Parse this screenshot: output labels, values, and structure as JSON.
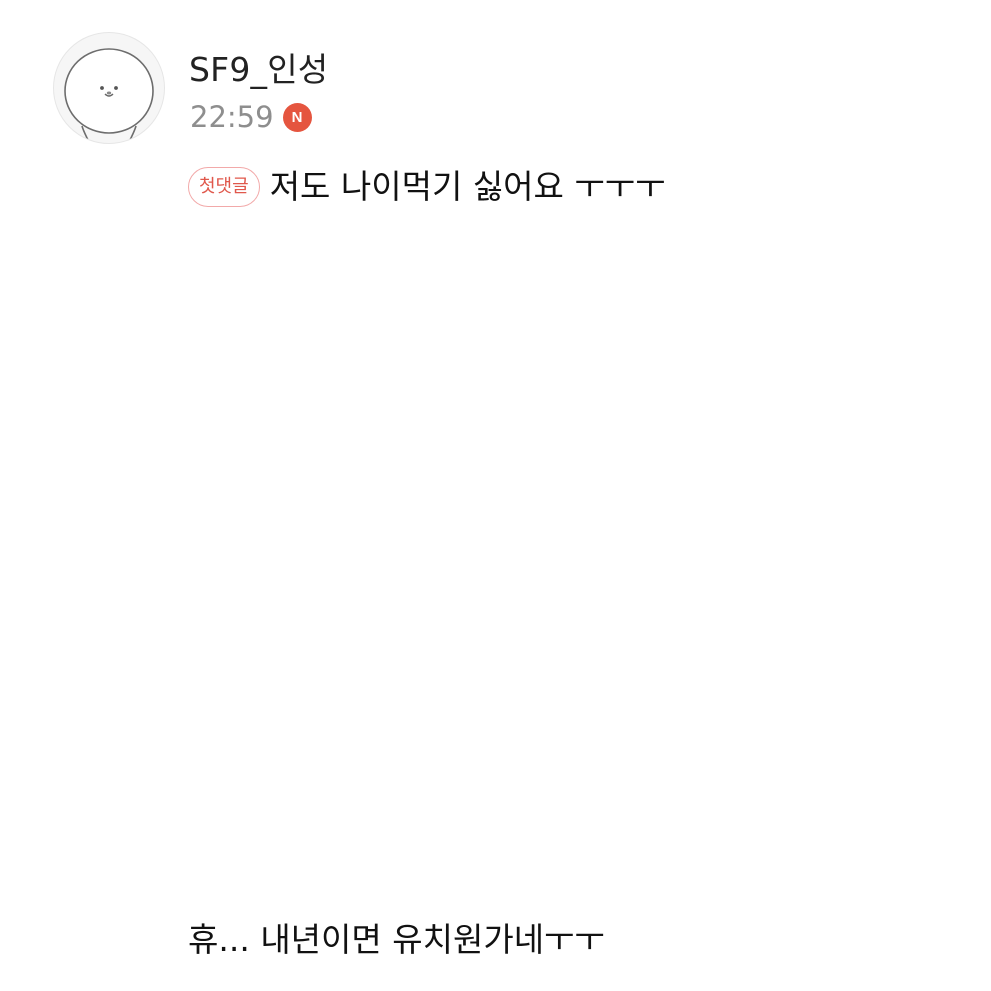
{
  "comment": {
    "author": "SF9_인성",
    "time": "22:59",
    "new_badge": "N",
    "first_comment_badge": "첫댓글",
    "text": "저도 나이먹기 싫어요 ㅜㅜㅜ",
    "avatar_icon": "cartoon-face-avatar-icon"
  },
  "bottom": {
    "text": "휴... 내년이면 유치원가네ㅜㅜ"
  },
  "colors": {
    "new_badge_bg": "#e5553f",
    "first_badge_text": "#e0584c",
    "first_badge_border": "#f2a9a9",
    "timestamp": "#8e8e8e"
  }
}
